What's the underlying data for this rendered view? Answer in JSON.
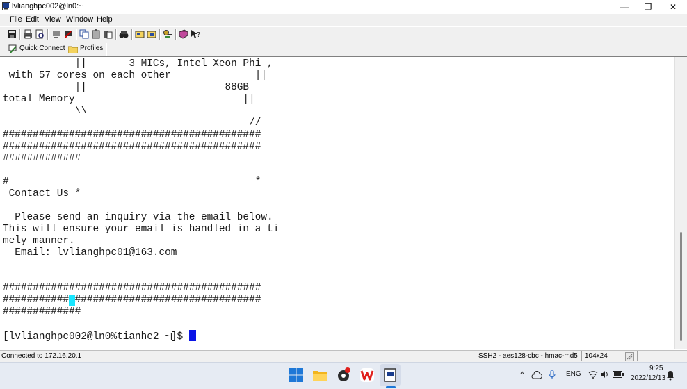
{
  "window": {
    "title": "lvlianghpc002@ln0:~",
    "minimize": "—",
    "maximize": "❐",
    "close": "✕"
  },
  "menu": [
    "File",
    "Edit",
    "View",
    "Window",
    "Help"
  ],
  "toolbar2": {
    "quick_connect": "Quick Connect",
    "profiles": "Profiles"
  },
  "terminal": {
    "lines": [
      "            ||       3 MICs, Intel Xeon Phi ,",
      " with 57 cores on each other              ||",
      "            ||                       88GB",
      "total Memory                            ||",
      "            \\\\",
      "                                         //",
      "###########################################",
      "###########################################",
      "#############",
      "",
      "#                                         *",
      " Contact Us *",
      "",
      "  Please send an inquiry via the email below.",
      "This will ensure your email is handled in a ti",
      "mely manner.",
      "  Email: lvlianghpc01@163.com",
      "",
      "",
      "###########################################"
    ],
    "highlight_line": {
      "before": "###########",
      "highlight": "#",
      "after": "###############################"
    },
    "after_lines": [
      "#############",
      ""
    ],
    "prompt": "[lvlianghpc002@ln0%tianhe2 ~]$ "
  },
  "status": {
    "connection": "Connected to 172.16.20.1",
    "protocol": "SSH2 - aes128-cbc - hmac-md5",
    "size": "104x24"
  },
  "tray": {
    "lang": "ENG",
    "time": "9:25",
    "date": "2022/12/13"
  }
}
